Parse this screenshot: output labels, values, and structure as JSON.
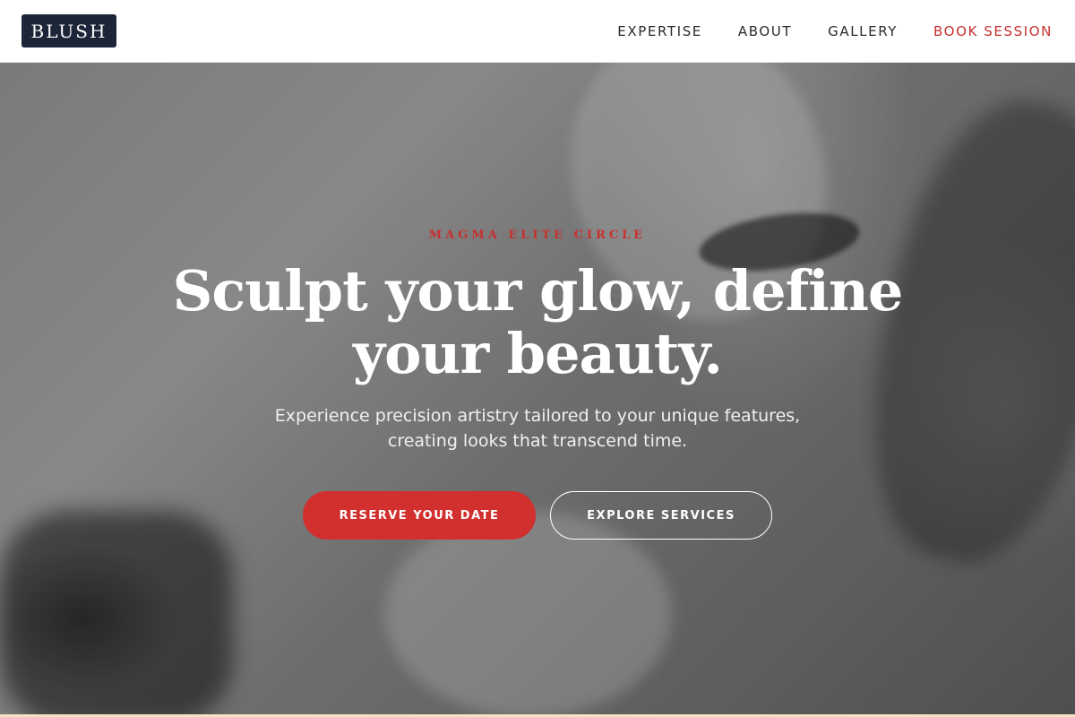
{
  "header": {
    "logo": "BLUSH",
    "nav": [
      {
        "label": "EXPERTISE"
      },
      {
        "label": "ABOUT"
      },
      {
        "label": "GALLERY"
      },
      {
        "label": "BOOK SESSION"
      }
    ]
  },
  "hero": {
    "eyebrow": "MAGMA ELITE CIRCLE",
    "title": "Sculpt your glow, define your beauty.",
    "subtitle": "Experience precision artistry tailored to your unique features, creating looks that transcend time.",
    "primary_button": "RESERVE YOUR DATE",
    "secondary_button": "EXPLORE SERVICES"
  },
  "colors": {
    "accent": "#c8302f",
    "primary_button": "#d22f2f",
    "logo_bg": "#1d2638"
  }
}
